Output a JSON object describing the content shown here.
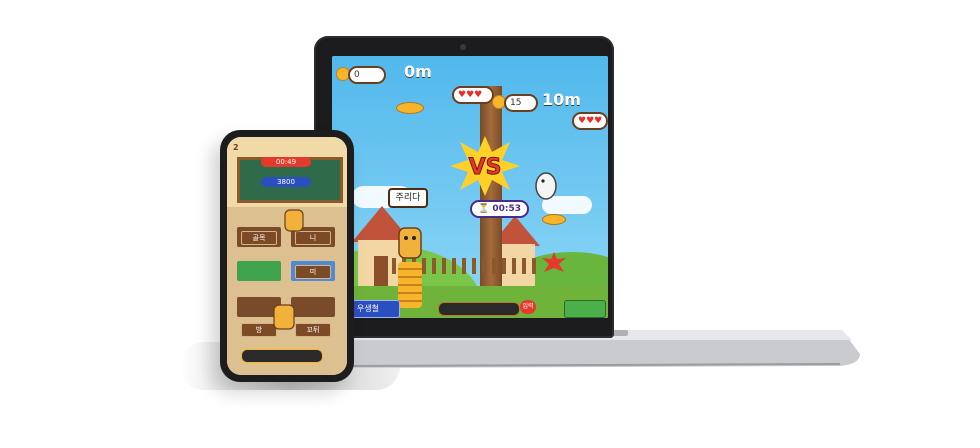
{
  "laptop_game": {
    "p1_coins": "0",
    "p1_distance": "0m",
    "p2_coins": "15",
    "p2_distance": "10m",
    "vs_label": "VS",
    "speech_text": "주리다",
    "timer": "00:53",
    "bottom_left_button": "우생철",
    "bottom_center_button": "입력",
    "colors": {
      "sky": "#51b8ec",
      "grass": "#6fb33a",
      "coin": "#f7b52c",
      "heart": "#e4312b",
      "vs_red": "#e33a2c",
      "vs_yellow": "#ffd126"
    }
  },
  "phone_game": {
    "top_left_number": "2",
    "score_top": "00:49",
    "score_bottom": "3800",
    "desk_labels": [
      "골목",
      "니",
      "미",
      "방",
      "꼬뒤"
    ]
  }
}
